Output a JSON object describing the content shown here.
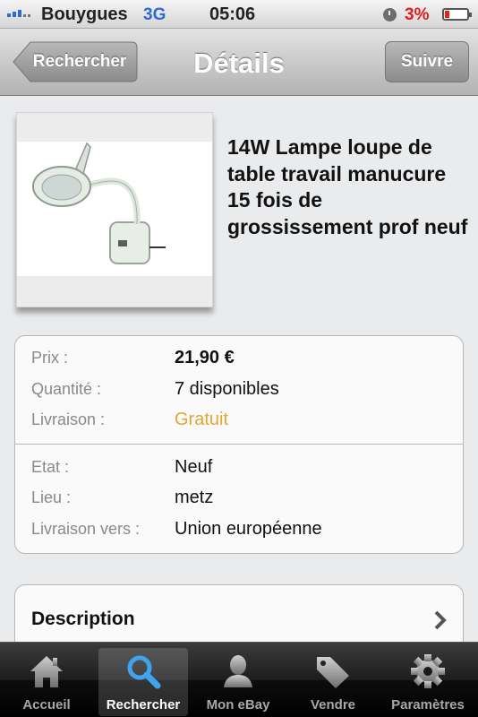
{
  "status_bar": {
    "carrier": "Bouygues",
    "network": "3G",
    "time": "05:06",
    "battery": "3%",
    "icons": [
      "signal-icon",
      "clock-icon",
      "battery-icon"
    ]
  },
  "nav": {
    "back_label": "Rechercher",
    "title": "Détails",
    "follow_label": "Suivre"
  },
  "product": {
    "title": "14W Lampe loupe de table travail manucure 15 fois de grossissement prof neuf",
    "image": "lamp-photo"
  },
  "info": {
    "price_label": "Prix :",
    "price": "21,90 €",
    "quantity_label": "Quantité :",
    "quantity": "7 disponibles",
    "shipping_label": "Livraison :",
    "shipping": "Gratuit",
    "condition_label": "Etat :",
    "condition": "Neuf",
    "location_label": "Lieu :",
    "location": "metz",
    "ships_to_label": "Livraison vers :",
    "ships_to": "Union européenne"
  },
  "description": {
    "label": "Description"
  },
  "colors": {
    "shipping_free": "#e4a531",
    "accent_blue": "#2e6ad3",
    "battery_low": "#d81e1e"
  },
  "tabs": [
    {
      "label": "Accueil",
      "icon": "home-icon",
      "active": false
    },
    {
      "label": "Rechercher",
      "icon": "search-icon",
      "active": true
    },
    {
      "label": "Mon eBay",
      "icon": "person-icon",
      "active": false
    },
    {
      "label": "Vendre",
      "icon": "tag-icon",
      "active": false
    },
    {
      "label": "Paramètres",
      "icon": "gear-icon",
      "active": false
    }
  ]
}
